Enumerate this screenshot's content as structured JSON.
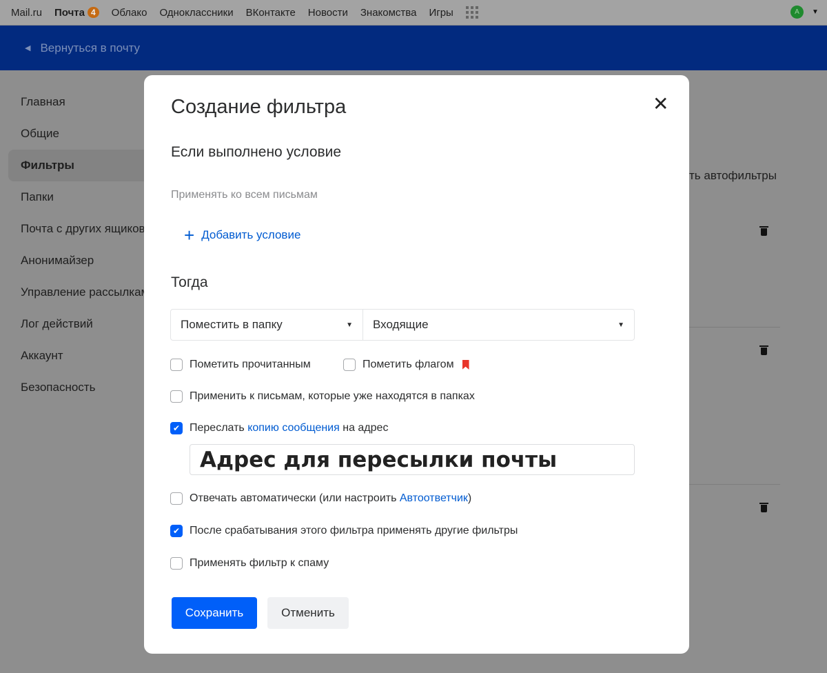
{
  "topbar": {
    "items": [
      {
        "label": "Mail.ru"
      },
      {
        "label": "Почта",
        "badge": "4"
      },
      {
        "label": "Облако"
      },
      {
        "label": "Одноклассники"
      },
      {
        "label": "ВКонтакте"
      },
      {
        "label": "Новости"
      },
      {
        "label": "Знакомства"
      },
      {
        "label": "Игры"
      }
    ],
    "avatar": "A",
    "apps_icon": "grid-icon"
  },
  "header": {
    "back_label": "Вернуться в почту"
  },
  "sidebar": {
    "items": [
      {
        "label": "Главная"
      },
      {
        "label": "Общие"
      },
      {
        "label": "Фильтры",
        "active": true
      },
      {
        "label": "Папки"
      },
      {
        "label": "Почта с других ящиков"
      },
      {
        "label": "Анонимайзер"
      },
      {
        "label": "Управление рассылками"
      },
      {
        "label": "Лог действий"
      },
      {
        "label": "Аккаунт"
      },
      {
        "label": "Безопасность"
      }
    ]
  },
  "background": {
    "autofilters_text": "ть автофильтры"
  },
  "modal": {
    "title": "Создание фильтра",
    "condition_heading": "Если выполнено условие",
    "condition_text": "Применять ко всем письмам",
    "add_condition": "Добавить условие",
    "then_heading": "Тогда",
    "action_select": "Поместить в папку",
    "folder_select": "Входящие",
    "options": {
      "mark_read": {
        "label": "Пометить прочитанным",
        "checked": false
      },
      "mark_flag": {
        "label": "Пометить флагом",
        "checked": false
      },
      "apply_existing": {
        "label": "Применить к письмам, которые уже находятся в папках",
        "checked": false
      },
      "forward": {
        "pre": "Переслать ",
        "link": "копию сообщения",
        "post": " на адрес",
        "checked": true
      },
      "autoreply": {
        "pre": "Отвечать автоматически (или настроить ",
        "link": "Автоответчик",
        "post": ")",
        "checked": false
      },
      "continue": {
        "label": "После срабатывания этого фильтра применять другие фильтры",
        "checked": true
      },
      "spam": {
        "label": "Применять фильтр к спаму",
        "checked": false
      }
    },
    "forward_address": "Адрес для пересылки почты",
    "save": "Сохранить",
    "cancel": "Отменить"
  },
  "colors": {
    "accent": "#005ff9",
    "link": "#005bd1",
    "flag": "#e8352a"
  }
}
